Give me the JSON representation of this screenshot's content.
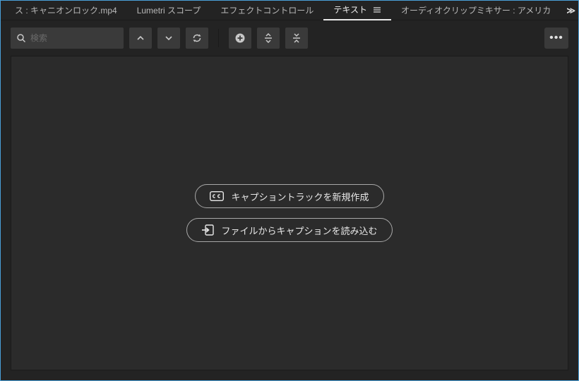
{
  "tabs": {
    "source": "ス : キャニオンロック.mp4",
    "lumetri": "Lumetri スコープ",
    "effect": "エフェクトコントロール",
    "text": "テキスト",
    "audio": "オーディオクリップミキサー : アメリカ",
    "overflow": "≫"
  },
  "search": {
    "placeholder": "検索"
  },
  "actions": {
    "create_caption_track": "キャプショントラックを新規作成",
    "import_caption_file": "ファイルからキャプションを読み込む"
  }
}
